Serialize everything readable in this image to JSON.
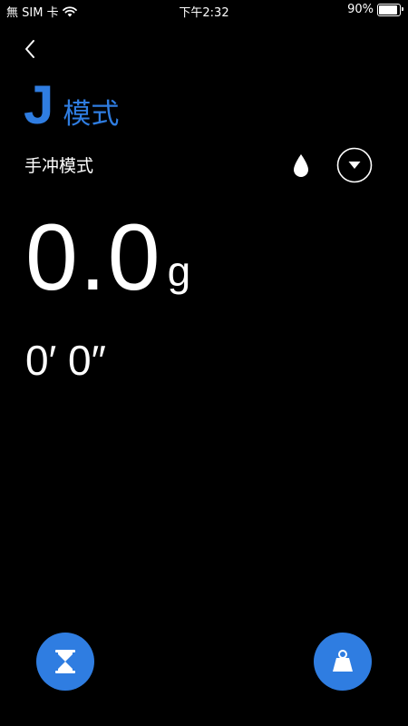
{
  "status_bar": {
    "carrier": "無 SIM 卡",
    "time": "下午2:32",
    "battery": "90%",
    "battery_level": 0.9
  },
  "header": {
    "mode_letter": "J",
    "mode_word": "模式"
  },
  "submode": {
    "label": "手冲模式"
  },
  "readout": {
    "weight": "0.0",
    "unit": "g",
    "timer": "0′ 0″"
  },
  "icons": {
    "back": "chevron-left-icon",
    "drop": "water-drop-icon",
    "dropdown": "triangle-down-icon",
    "timer": "hourglass-icon",
    "tare": "weight-icon"
  },
  "colors": {
    "accent": "#2f7de1",
    "background": "#000000",
    "text": "#ffffff"
  }
}
